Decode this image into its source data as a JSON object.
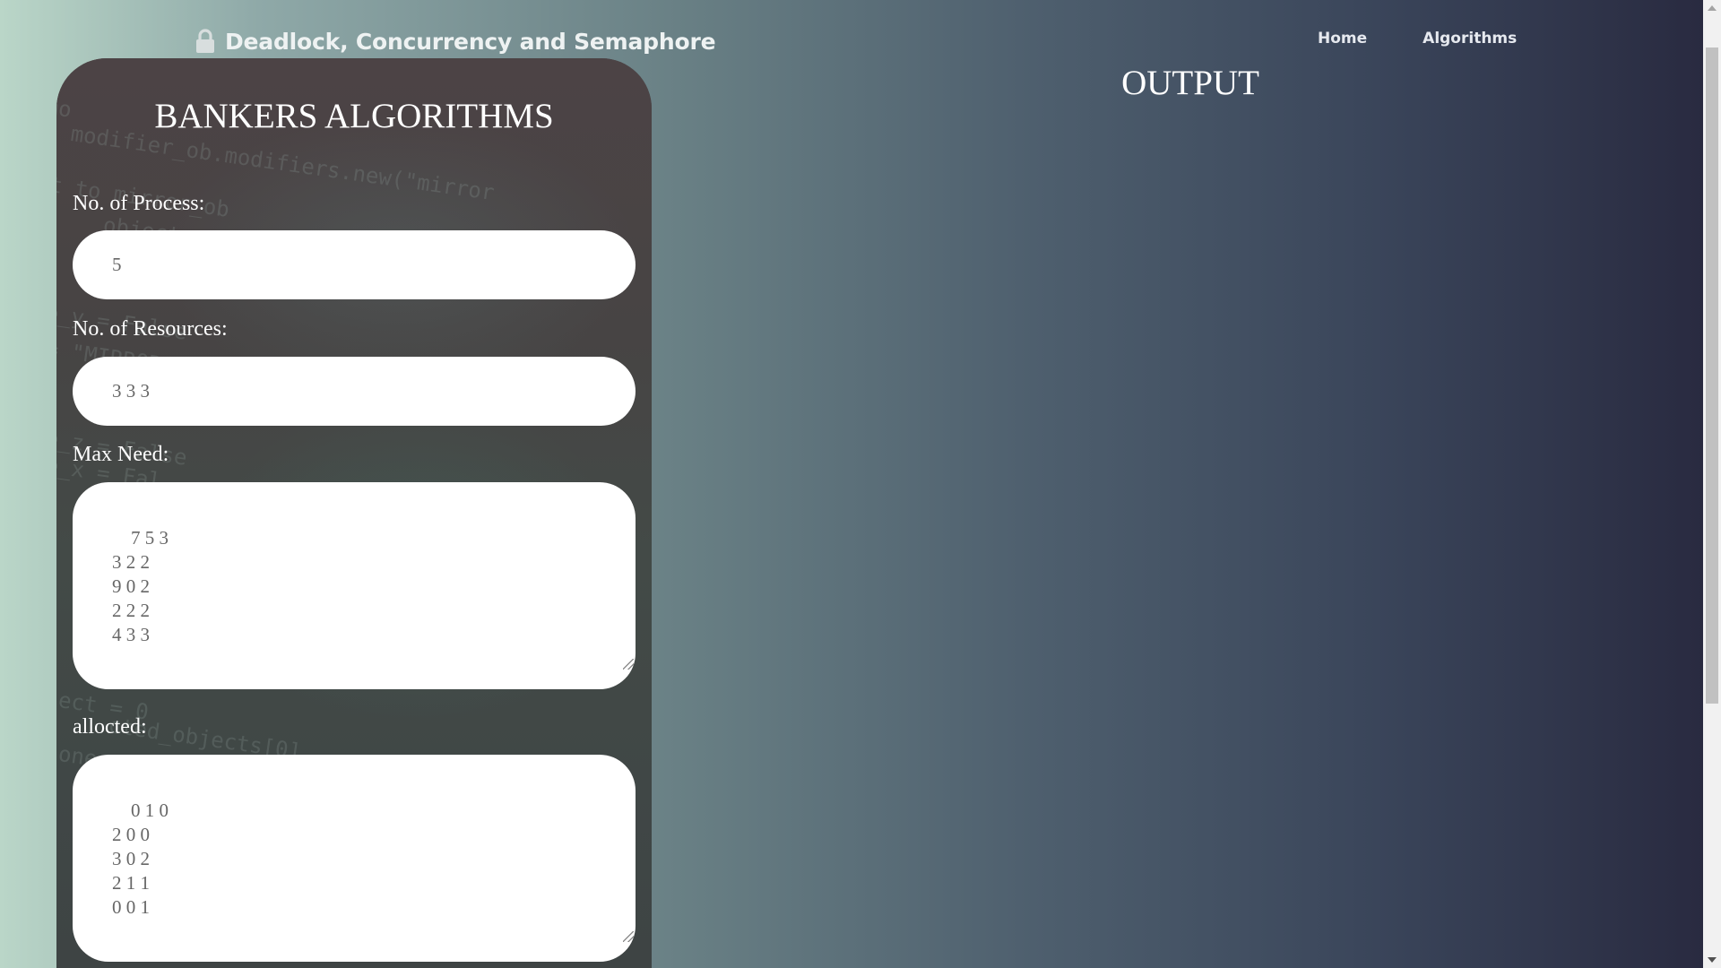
{
  "navbar": {
    "brand_icon": "lock-icon",
    "brand_title": "Deadlock, Concurrency and Semaphore",
    "links": [
      {
        "label": "Home"
      },
      {
        "label": "Algorithms"
      }
    ]
  },
  "form": {
    "title": "BANKERS ALGORITHMS",
    "process_label": "No. of Process:",
    "process_value": "5",
    "resources_label": "No. of Resources:",
    "resources_value": "3 3 3",
    "max_need_label": "Max Need:",
    "max_need_value": "7 5 3\n3 2 2\n9 0 2\n2 2 2\n4 3 3",
    "allocated_label": "allocted:",
    "allocated_value": "0 1 0\n2 0 0\n3 0 2\n2 1 1\n0 0 1"
  },
  "output": {
    "title": "OUTPUT"
  },
  "colors": {
    "gradient_left": "#bad6c8",
    "gradient_right": "#28293f",
    "card_bg": "#4b4345",
    "text_white": "#ffffff"
  }
}
